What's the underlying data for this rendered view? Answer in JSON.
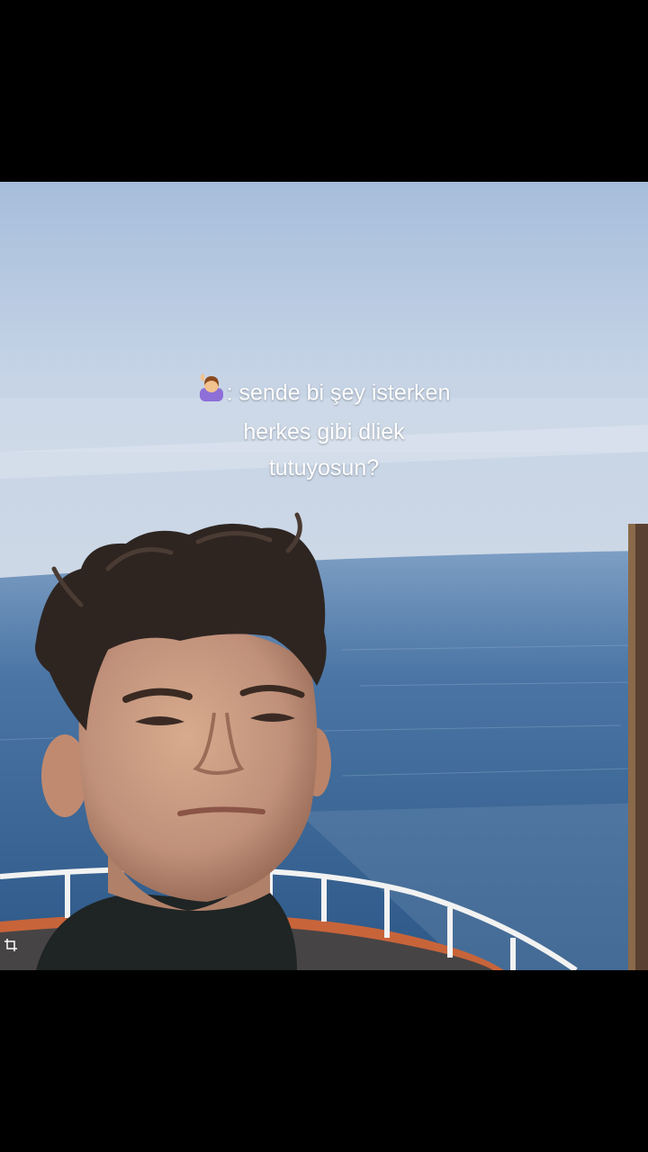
{
  "caption": {
    "emoji_icon": "person-raising-hand-icon",
    "line1_text": ": sende bi şey isterken",
    "line2_text": "herkes gibi dliek",
    "line3_text": "tutuyosun?"
  },
  "photo": {
    "subject": "boy-selfie-on-boat",
    "colors": {
      "sky": "#bccde3",
      "sea": "#3a6797",
      "hair": "#2e2521",
      "skin": "#c59a7e",
      "railing": "#eeeeee",
      "hull_trim": "#c8643a"
    }
  },
  "overlay": {
    "corner_icon": "crop-icon"
  }
}
